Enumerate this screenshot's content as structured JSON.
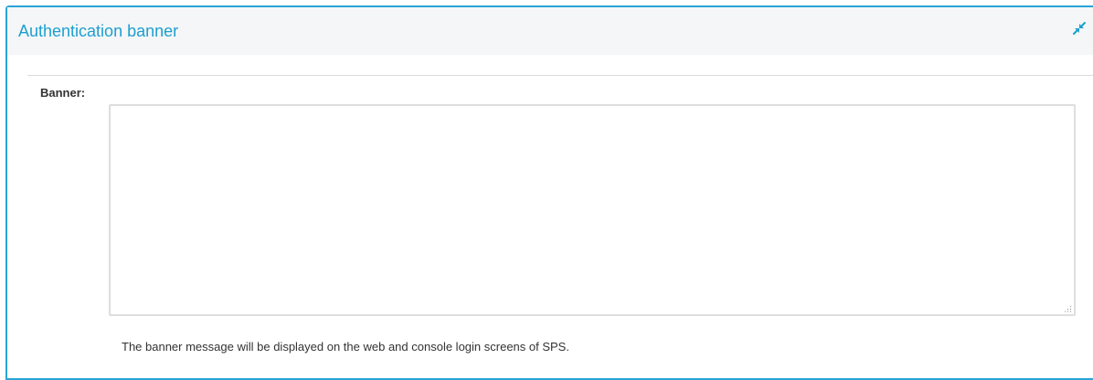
{
  "panel": {
    "title": "Authentication banner",
    "collapse_icon": "collapse-arrows-icon",
    "accent_color": "#2aa4d5"
  },
  "form": {
    "banner_label": "Banner:",
    "banner_value": "",
    "banner_placeholder": "",
    "help_text": "The banner message will be displayed on the web and console login screens of SPS."
  }
}
